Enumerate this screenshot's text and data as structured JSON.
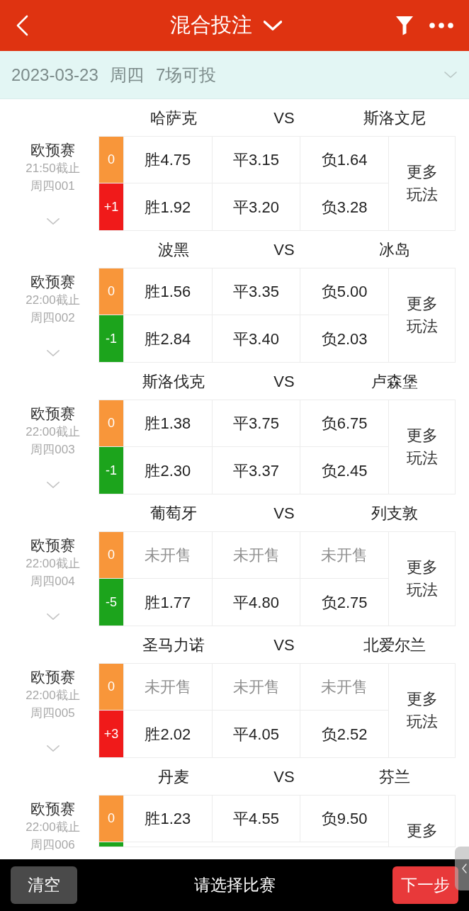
{
  "header": {
    "title": "混合投注"
  },
  "date_bar": {
    "text": "2023-03-23 周四 7场可投"
  },
  "matches": [
    {
      "home": "哈萨克",
      "vs": "VS",
      "away": "斯洛文尼",
      "league": "欧预赛",
      "deadline": "21:50截止",
      "code": "周四001",
      "more": "更多玩法",
      "rows": [
        {
          "handicap": "0",
          "color": "#f8963a",
          "odds": [
            {
              "text": "胜4.75",
              "disabled": false
            },
            {
              "text": "平3.15",
              "disabled": false
            },
            {
              "text": "负1.64",
              "disabled": false
            }
          ]
        },
        {
          "handicap": "+1",
          "color": "#f01a1a",
          "odds": [
            {
              "text": "胜1.92",
              "disabled": false
            },
            {
              "text": "平3.20",
              "disabled": false
            },
            {
              "text": "负3.28",
              "disabled": false
            }
          ]
        }
      ]
    },
    {
      "home": "波黑",
      "vs": "VS",
      "away": "冰岛",
      "league": "欧预赛",
      "deadline": "22:00截止",
      "code": "周四002",
      "more": "更多玩法",
      "rows": [
        {
          "handicap": "0",
          "color": "#f8963a",
          "odds": [
            {
              "text": "胜1.56",
              "disabled": false
            },
            {
              "text": "平3.35",
              "disabled": false
            },
            {
              "text": "负5.00",
              "disabled": false
            }
          ]
        },
        {
          "handicap": "-1",
          "color": "#1ca41c",
          "odds": [
            {
              "text": "胜2.84",
              "disabled": false
            },
            {
              "text": "平3.40",
              "disabled": false
            },
            {
              "text": "负2.03",
              "disabled": false
            }
          ]
        }
      ]
    },
    {
      "home": "斯洛伐克",
      "vs": "VS",
      "away": "卢森堡",
      "league": "欧预赛",
      "deadline": "22:00截止",
      "code": "周四003",
      "more": "更多玩法",
      "rows": [
        {
          "handicap": "0",
          "color": "#f8963a",
          "odds": [
            {
              "text": "胜1.38",
              "disabled": false
            },
            {
              "text": "平3.75",
              "disabled": false
            },
            {
              "text": "负6.75",
              "disabled": false
            }
          ]
        },
        {
          "handicap": "-1",
          "color": "#1ca41c",
          "odds": [
            {
              "text": "胜2.30",
              "disabled": false
            },
            {
              "text": "平3.37",
              "disabled": false
            },
            {
              "text": "负2.45",
              "disabled": false
            }
          ]
        }
      ]
    },
    {
      "home": "葡萄牙",
      "vs": "VS",
      "away": "列支敦",
      "league": "欧预赛",
      "deadline": "22:00截止",
      "code": "周四004",
      "more": "更多玩法",
      "rows": [
        {
          "handicap": "0",
          "color": "#f8963a",
          "odds": [
            {
              "text": "未开售",
              "disabled": true
            },
            {
              "text": "未开售",
              "disabled": true
            },
            {
              "text": "未开售",
              "disabled": true
            }
          ]
        },
        {
          "handicap": "-5",
          "color": "#1ca41c",
          "odds": [
            {
              "text": "胜1.77",
              "disabled": false
            },
            {
              "text": "平4.80",
              "disabled": false
            },
            {
              "text": "负2.75",
              "disabled": false
            }
          ]
        }
      ]
    },
    {
      "home": "圣马力诺",
      "vs": "VS",
      "away": "北爱尔兰",
      "league": "欧预赛",
      "deadline": "22:00截止",
      "code": "周四005",
      "more": "更多玩法",
      "rows": [
        {
          "handicap": "0",
          "color": "#f8963a",
          "odds": [
            {
              "text": "未开售",
              "disabled": true
            },
            {
              "text": "未开售",
              "disabled": true
            },
            {
              "text": "未开售",
              "disabled": true
            }
          ]
        },
        {
          "handicap": "+3",
          "color": "#f01a1a",
          "odds": [
            {
              "text": "胜2.02",
              "disabled": false
            },
            {
              "text": "平4.05",
              "disabled": false
            },
            {
              "text": "负2.52",
              "disabled": false
            }
          ]
        }
      ]
    },
    {
      "home": "丹麦",
      "vs": "VS",
      "away": "芬兰",
      "league": "欧预赛",
      "deadline": "22:00截止",
      "code": "周四006",
      "more": "更多",
      "rows": [
        {
          "handicap": "0",
          "color": "#f8963a",
          "odds": [
            {
              "text": "胜1.23",
              "disabled": false
            },
            {
              "text": "平4.55",
              "disabled": false
            },
            {
              "text": "负9.50",
              "disabled": false
            }
          ]
        },
        {
          "color": "#1ca41c"
        }
      ]
    }
  ],
  "footer": {
    "clear_button": "清空",
    "prompt": "请选择比赛",
    "next_button": "下一步"
  }
}
